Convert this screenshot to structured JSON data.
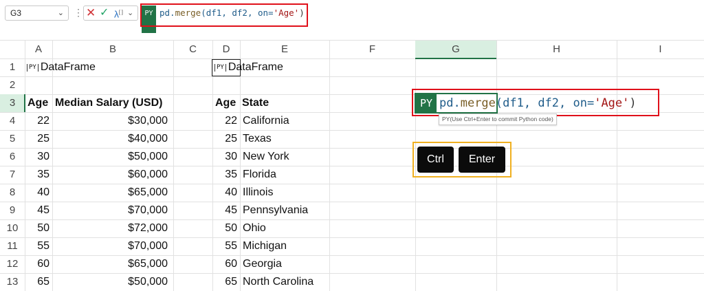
{
  "formula_bar": {
    "name_box": "G3",
    "py_badge": "PY",
    "formula_parts": {
      "fn_obj": "pd.",
      "fn_name": "merge",
      "args": "(df1, df2, on=",
      "arg_str": "'Age'",
      "close": ")"
    },
    "formula": "pd.merge(df1, df2, on='Age')"
  },
  "columns": [
    "A",
    "B",
    "C",
    "D",
    "E",
    "F",
    "G",
    "H",
    "I"
  ],
  "rows": [
    "1",
    "2",
    "3",
    "4",
    "5",
    "6",
    "7",
    "8",
    "9",
    "10",
    "11",
    "12",
    "13"
  ],
  "sheet": {
    "a1": "DataFrame",
    "d1": "DataFrame",
    "headers": {
      "a3": "Age",
      "b3": "Median Salary (USD)",
      "d3": "Age",
      "e3": "State"
    },
    "table1": [
      {
        "age": "22",
        "salary": "$30,000"
      },
      {
        "age": "25",
        "salary": "$40,000"
      },
      {
        "age": "30",
        "salary": "$50,000"
      },
      {
        "age": "35",
        "salary": "$60,000"
      },
      {
        "age": "40",
        "salary": "$65,000"
      },
      {
        "age": "45",
        "salary": "$70,000"
      },
      {
        "age": "50",
        "salary": "$72,000"
      },
      {
        "age": "55",
        "salary": "$70,000"
      },
      {
        "age": "60",
        "salary": "$65,000"
      },
      {
        "age": "65",
        "salary": "$50,000"
      }
    ],
    "table2": [
      {
        "age": "22",
        "state": "California"
      },
      {
        "age": "25",
        "state": "Texas"
      },
      {
        "age": "30",
        "state": "New York"
      },
      {
        "age": "35",
        "state": "Florida"
      },
      {
        "age": "40",
        "state": "Illinois"
      },
      {
        "age": "45",
        "state": "Pennsylvania"
      },
      {
        "age": "50",
        "state": "Ohio"
      },
      {
        "age": "55",
        "state": "Michigan"
      },
      {
        "age": "60",
        "state": "Georgia"
      },
      {
        "age": "65",
        "state": "North Carolina"
      }
    ],
    "g3_badge": "PY",
    "tooltip": "PY(Use Ctrl+Enter to commit Python code)"
  },
  "keys": {
    "ctrl": "Ctrl",
    "enter": "Enter"
  },
  "colors": {
    "excel_green": "#217346",
    "highlight_red": "#e0101a",
    "highlight_orange": "#f0b020"
  },
  "icons": {
    "cancel": "close-icon",
    "enter": "check-icon",
    "insert_function": "function-icon"
  }
}
